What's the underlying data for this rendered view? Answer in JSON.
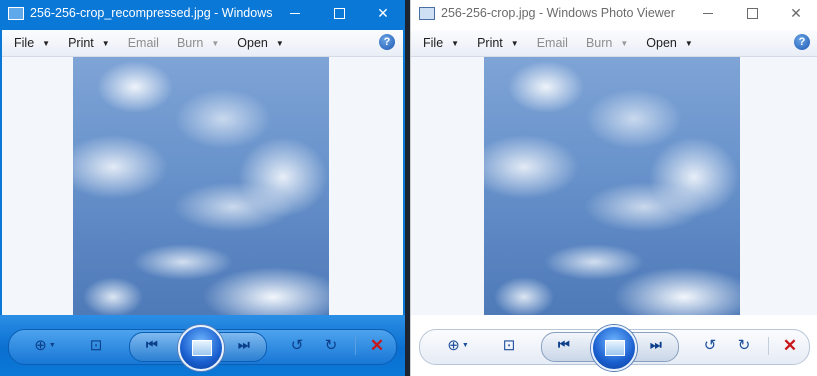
{
  "windows": [
    {
      "title": "256-256-crop_recompressed.jpg - Windows...",
      "active": true,
      "menu": [
        {
          "label": "File",
          "enabled": true
        },
        {
          "label": "Print",
          "enabled": true
        },
        {
          "label": "Email",
          "enabled": false
        },
        {
          "label": "Burn",
          "enabled": false
        },
        {
          "label": "Open",
          "enabled": true
        }
      ],
      "image_description_icon": "sky-clouds-photo"
    },
    {
      "title": "256-256-crop.jpg - Windows Photo Viewer",
      "active": false,
      "menu": [
        {
          "label": "File",
          "enabled": true
        },
        {
          "label": "Print",
          "enabled": true
        },
        {
          "label": "Email",
          "enabled": false
        },
        {
          "label": "Burn",
          "enabled": false
        },
        {
          "label": "Open",
          "enabled": true
        }
      ],
      "image_description_icon": "sky-clouds-photo"
    }
  ],
  "icons": {
    "zoom": "magnifier-plus-icon",
    "fit": "actual-size-icon",
    "prev": "previous-icon",
    "slideshow": "slideshow-icon",
    "next": "next-icon",
    "rotate_ccw": "rotate-counterclockwise-icon",
    "rotate_cw": "rotate-clockwise-icon",
    "delete": "delete-icon",
    "help": "help-icon"
  },
  "colors": {
    "active_titlebar": "#0a78d7",
    "inactive_titlebar": "#ffffff",
    "delete_red": "#c8171b"
  }
}
